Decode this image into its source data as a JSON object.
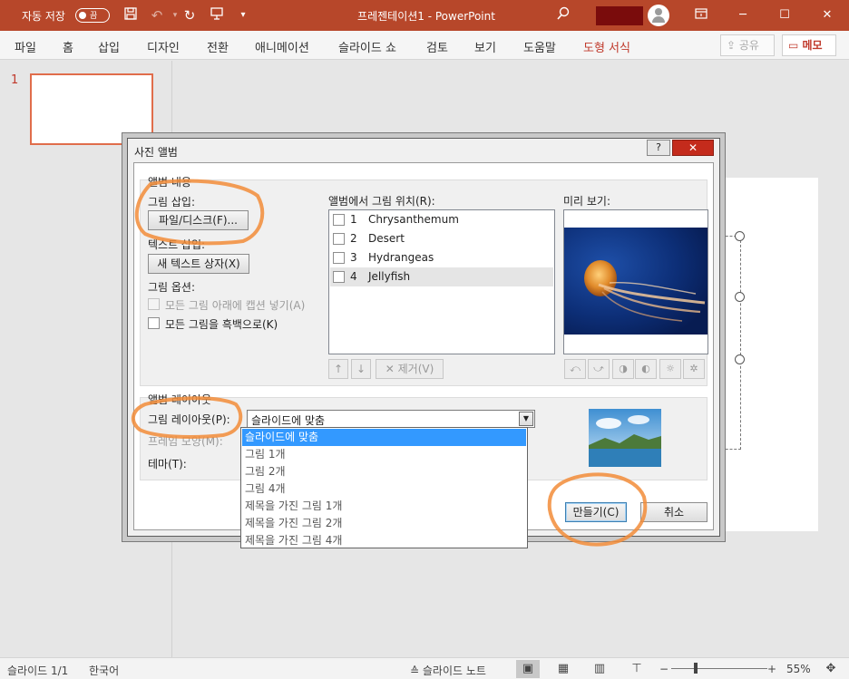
{
  "titlebar": {
    "autosave_label": "자동 저장",
    "autosave_state": "끔",
    "title": "프레젠테이션1 - PowerPoint",
    "minimize": "─",
    "maximize": "☐",
    "close": "✕"
  },
  "ribbon": {
    "tabs": [
      "파일",
      "홈",
      "삽입",
      "디자인",
      "전환",
      "애니메이션",
      "슬라이드 쇼",
      "검토",
      "보기",
      "도움말"
    ],
    "context_tab": "도형 서식",
    "share": "공유",
    "memo": "메모"
  },
  "slides": {
    "current_number": "1"
  },
  "dialog": {
    "title": "사진 앨범",
    "help": "?",
    "close": "✕",
    "album_content": "앨범 내용",
    "insert_picture_from": "그림 삽입:",
    "file_disk_button": "파일/디스크(F)...",
    "insert_text": "텍스트 삽입:",
    "new_text_box_button": "새 텍스트 상자(X)",
    "picture_options": "그림 옵션:",
    "option_captions": "모든 그림 아래에 캡션 넣기(A)",
    "option_black_white": "모든 그림을 흑백으로(K)",
    "pictures_in_album": "앨범에서 그림 위치(R):",
    "pictures": [
      {
        "num": "1",
        "name": "Chrysanthemum"
      },
      {
        "num": "2",
        "name": "Desert"
      },
      {
        "num": "3",
        "name": "Hydrangeas"
      },
      {
        "num": "4",
        "name": "Jellyfish"
      }
    ],
    "remove_button": "제거(V)",
    "preview_label": "미리 보기:",
    "album_layout": "앨범 레이아웃",
    "picture_layout_label": "그림 레이아웃(P):",
    "picture_layout_value": "슬라이드에 맞춤",
    "frame_shape_label": "프레임 모양(M):",
    "theme_label": "테마(T):",
    "layout_options": [
      "슬라이드에 맞춤",
      "그림 1개",
      "그림 2개",
      "그림 4개",
      "제목을 가진 그림 1개",
      "제목을 가진 그림 2개",
      "제목을 가진 그림 4개"
    ],
    "create_button": "만들기(C)",
    "cancel_button": "취소"
  },
  "statusbar": {
    "slide_info": "슬라이드 1/1",
    "language": "한국어",
    "notes": "슬라이드 노트",
    "zoom_minus": "−",
    "zoom_plus": "+",
    "zoom": "55%"
  },
  "colors": {
    "titlebar": "#b7472a",
    "accent_annotation": "#f28c38",
    "dropdown_selection": "#3399ff"
  }
}
